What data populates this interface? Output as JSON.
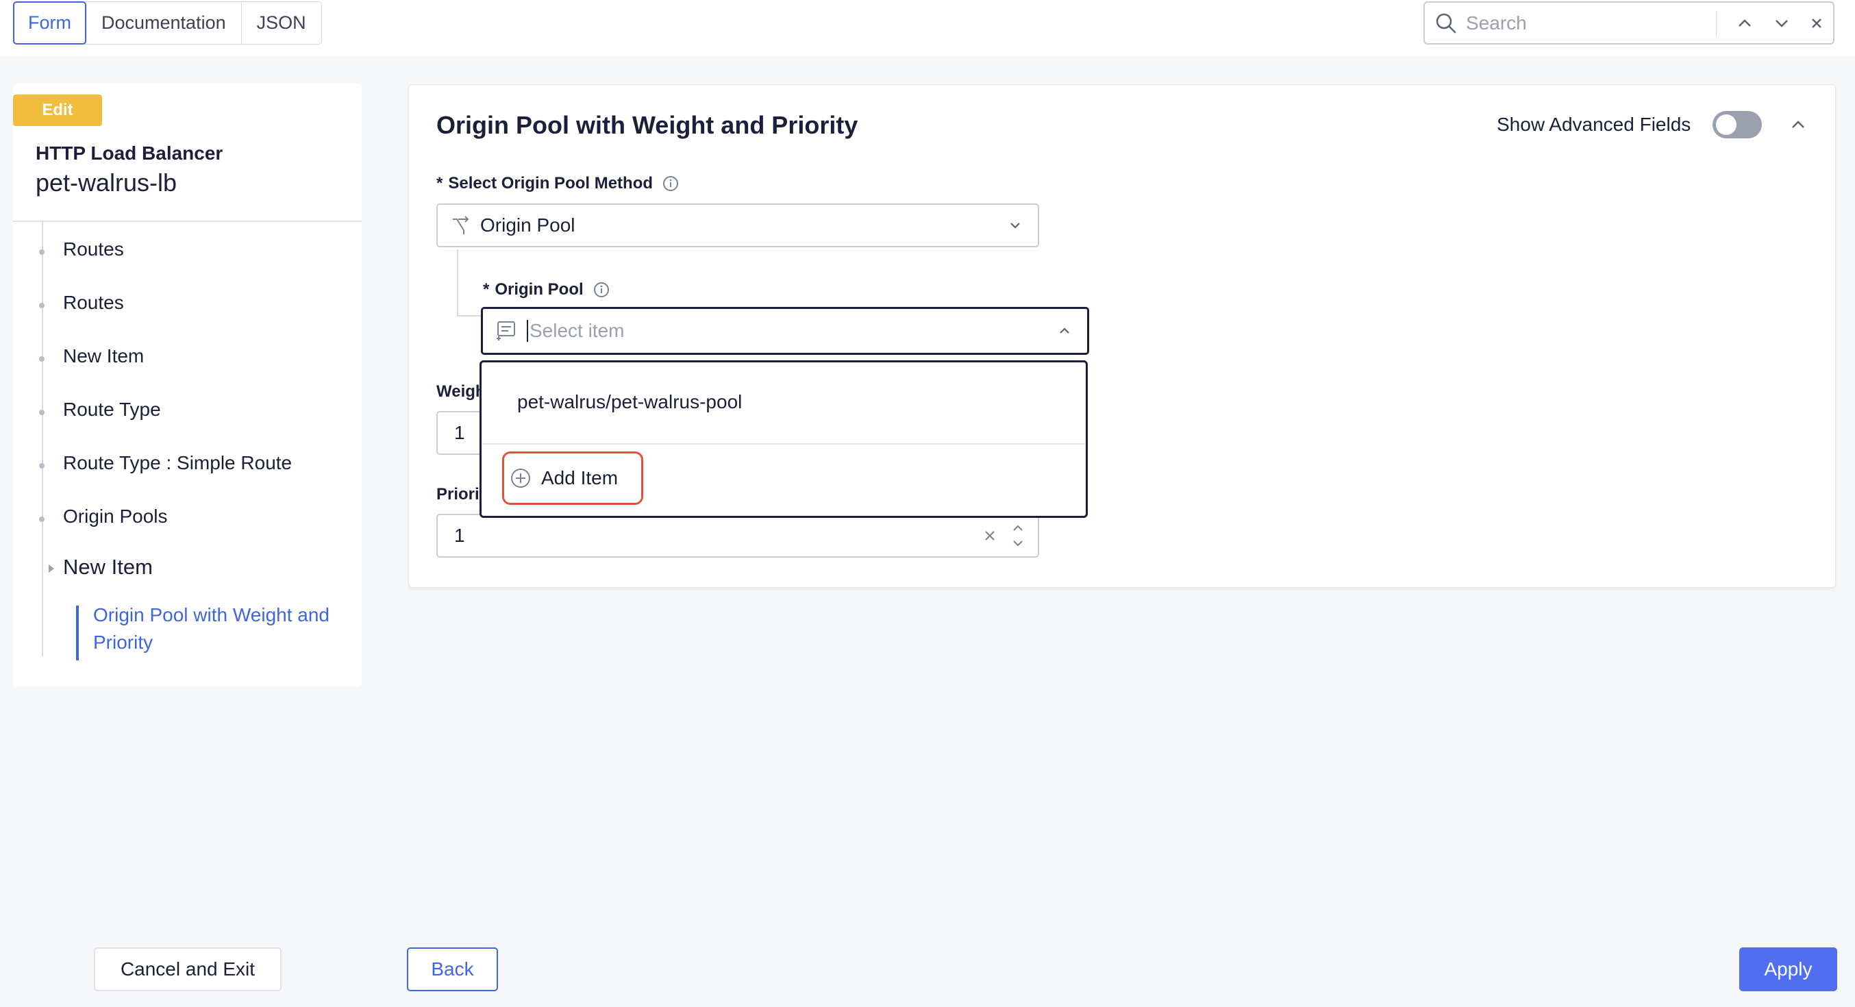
{
  "top_tabs": [
    {
      "label": "Form",
      "active": true
    },
    {
      "label": "Documentation",
      "active": false
    },
    {
      "label": "JSON",
      "active": false
    }
  ],
  "search": {
    "placeholder": "Search"
  },
  "sidebar": {
    "badge": "Edit",
    "object_type": "HTTP Load Balancer",
    "object_name": "pet-walrus-lb",
    "tree": [
      {
        "label": "Routes"
      },
      {
        "label": "Routes"
      },
      {
        "label": "New Item"
      },
      {
        "label": "Route Type"
      },
      {
        "label": "Route Type : Simple Route"
      },
      {
        "label": "Origin Pools"
      },
      {
        "label": "New Item"
      }
    ],
    "selected": "Origin Pool with Weight and Priority"
  },
  "card": {
    "title": "Origin Pool with Weight and Priority",
    "advanced_label": "Show Advanced Fields",
    "advanced_on": false,
    "method_label": "Select Origin Pool Method",
    "method_value": "Origin Pool",
    "origin_pool_label": "Origin Pool",
    "origin_pool_placeholder": "Select item",
    "weight_label": "Weight",
    "weight_value": "1",
    "priority_label": "Priority",
    "priority_value": "1",
    "required_mark": "*"
  },
  "dropdown": {
    "options": [
      "pet-walrus/pet-walrus-pool"
    ],
    "add_label": "Add Item"
  },
  "footer": {
    "cancel_label": "Cancel and Exit",
    "back_label": "Back",
    "apply_label": "Apply"
  },
  "colors": {
    "accent": "#3f66e0",
    "badge": "#f0bd3c",
    "highlight": "#e2543a",
    "apply": "#4f6ff0"
  },
  "icons": [
    "search-icon",
    "chevron-up-icon",
    "chevron-down-icon",
    "close-icon",
    "info-icon",
    "route-split-icon",
    "list-item-icon",
    "plus-circle-icon"
  ]
}
